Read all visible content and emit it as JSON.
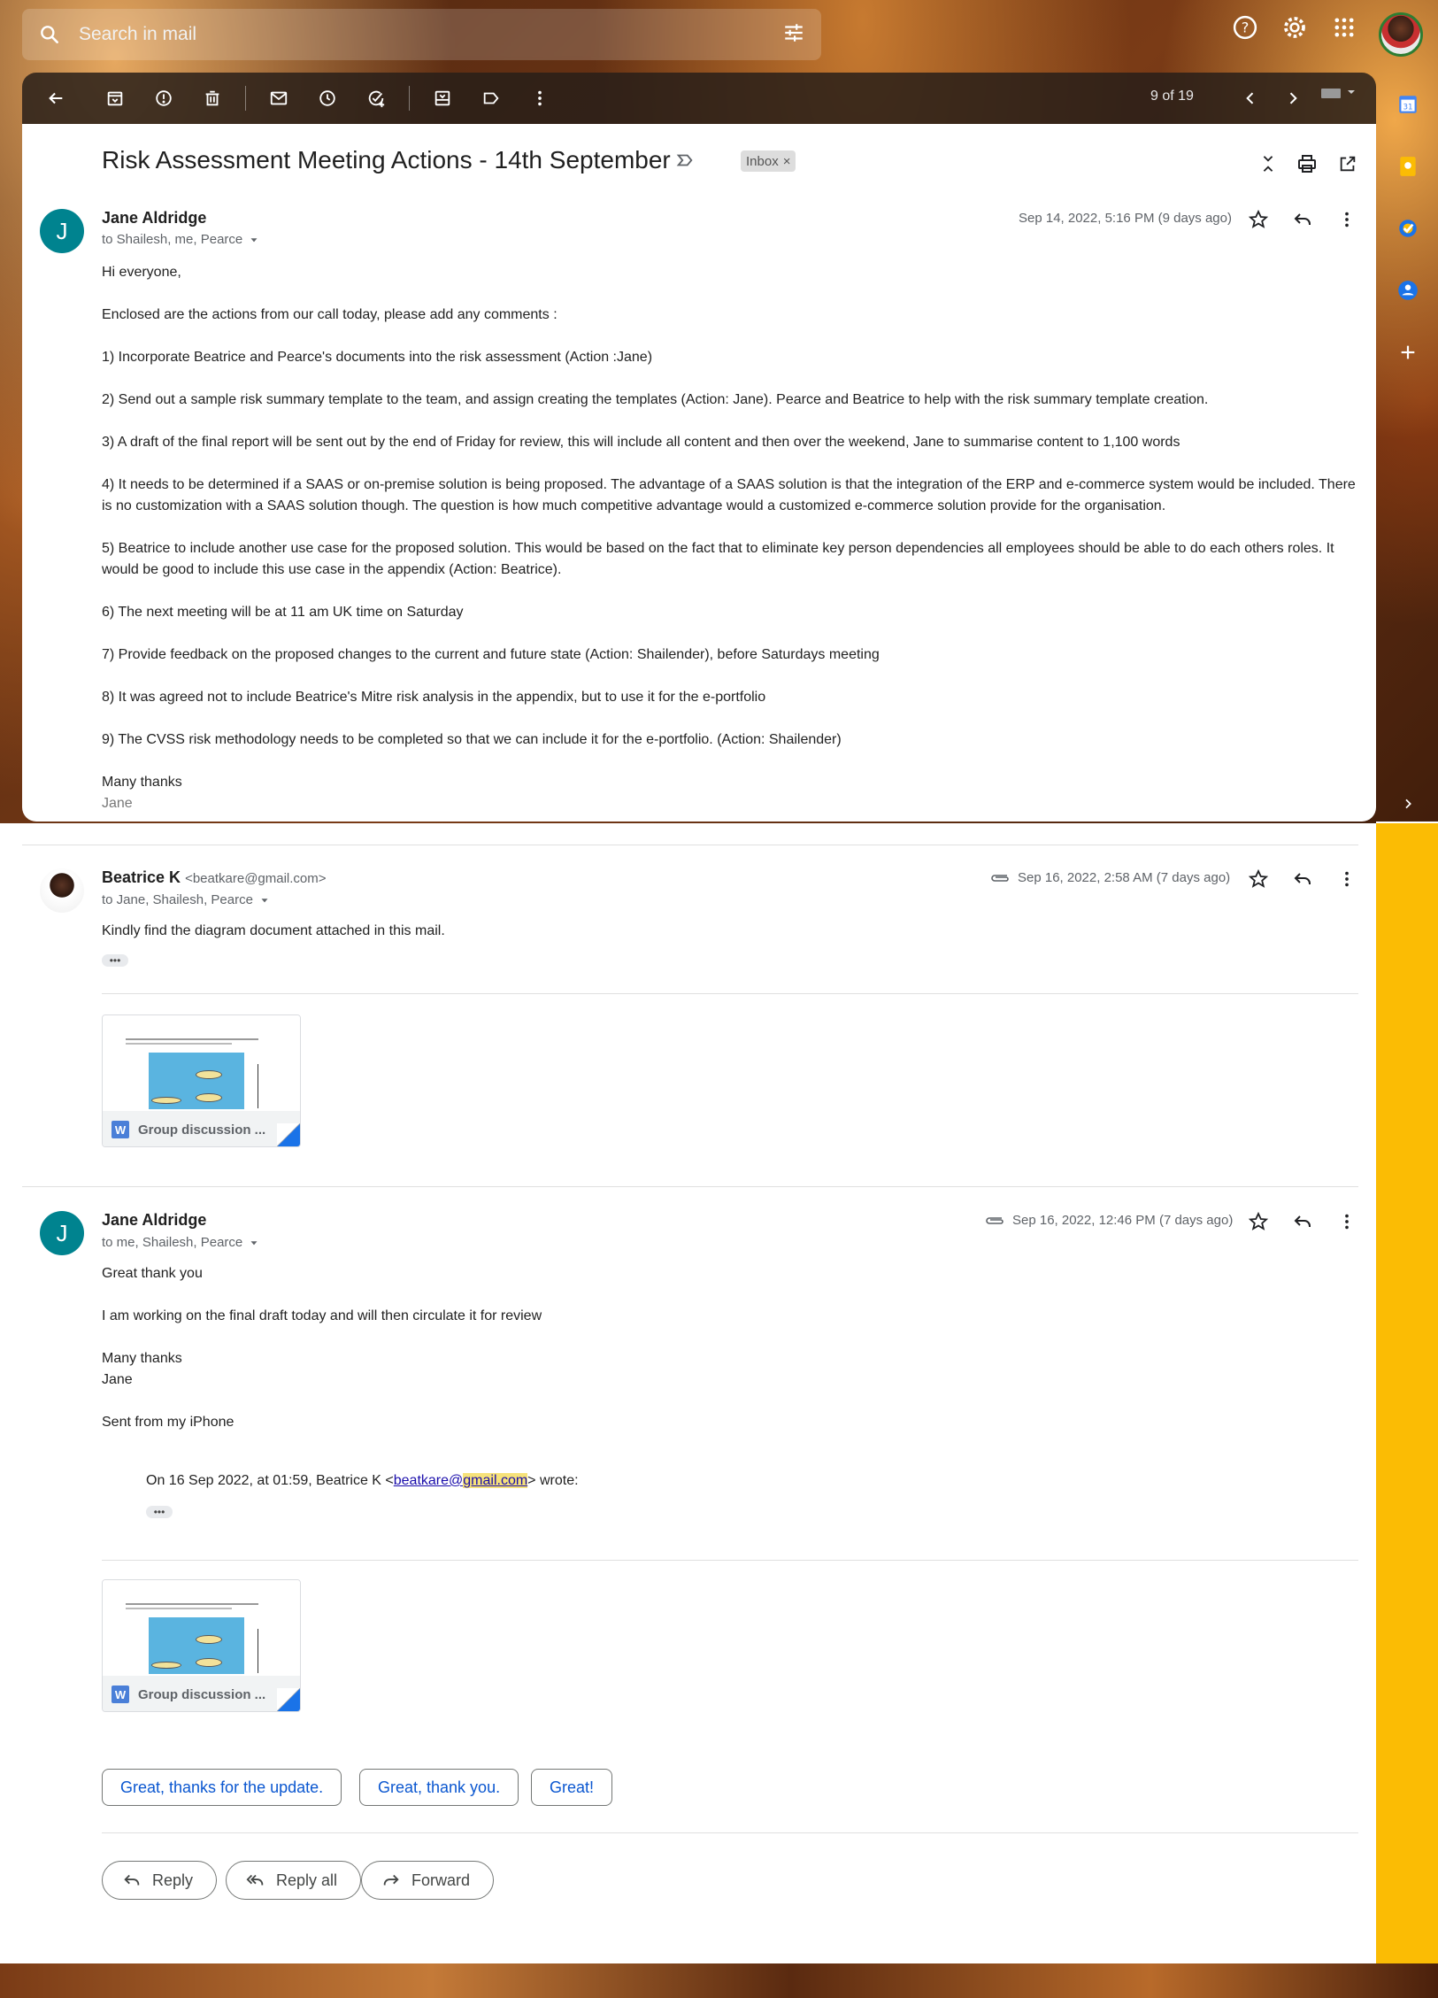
{
  "search": {
    "placeholder": "Search in mail"
  },
  "toolbar": {
    "count": "9 of 19"
  },
  "colors": {
    "accent": "#0b57d0",
    "avatar": "#00838f",
    "side_panel": "#fbbc04"
  },
  "thread": {
    "subject": "Risk Assessment Meeting Actions - 14th September",
    "label": "Inbox",
    "label_close": "×"
  },
  "messages": [
    {
      "avatar_letter": "J",
      "sender": "Jane Aldridge",
      "sender_email": "",
      "recipients": "to Shailesh, me, Pearce",
      "date": "Sep 14, 2022, 5:16 PM (9 days ago)",
      "body": [
        "Hi everyone,",
        "Enclosed are the actions from our call today, please add any comments :",
        "1) Incorporate Beatrice and Pearce's documents into the risk assessment (Action :Jane)",
        "2) Send out a sample risk summary template to the team, and assign creating the templates (Action: Jane). Pearce and Beatrice to help with the risk summary template creation.",
        "3) A draft of the final report will be sent out by the end of Friday for review, this will include all content and then over the weekend, Jane to summarise content to 1,100 words",
        "4) It needs to be determined if a SAAS or on-premise solution is being proposed. The advantage of  a SAAS solution is that the integration of the ERP and e-commerce system would be included. There is no customization with a SAAS solution though. The question is how much competitive advantage would a customized e-commerce solution provide for the organisation.",
        "5) Beatrice to include another use case for the proposed solution. This would be based on the fact that to eliminate key person dependencies all employees should be able to do each others roles. It would be good to include this use case in the appendix (Action: Beatrice).",
        "6) The next meeting will be at 11 am UK time on Saturday",
        "7) Provide feedback on the proposed changes to the current and future state (Action: Shailender), before Saturdays meeting",
        "8) It was agreed not to include Beatrice's Mitre risk analysis in the appendix, but to use it for the e-portfolio",
        "9) The CVSS risk methodology needs to be completed so that we can include it for the e-portfolio. (Action: Shailender)"
      ],
      "signoff": "Many thanks",
      "signature": "Jane"
    },
    {
      "sender": "Beatrice K",
      "sender_email": "<beatkare@gmail.com>",
      "recipients": "to Jane, Shailesh, Pearce",
      "date": "Sep 16, 2022, 2:58 AM (7 days ago)",
      "body": "Kindly find the diagram document attached in this mail.",
      "attachment": {
        "name": "Group discussion ...",
        "type_badge": "W"
      }
    },
    {
      "avatar_letter": "J",
      "sender": "Jane Aldridge",
      "recipients": "to me, Shailesh, Pearce",
      "date": "Sep 16, 2022, 12:46 PM (7 days ago)",
      "body": [
        "Great thank you",
        "I am working on the final draft today and will then circulate it for review"
      ],
      "signoff": "Many thanks",
      "signature": "Jane",
      "sent_from": "Sent from my iPhone",
      "quote_prefix": "On 16 Sep 2022, at 01:59, Beatrice K <",
      "quote_link_a": "beatkare@",
      "quote_link_b": "gmail.com",
      "quote_suffix": "> wrote:",
      "attachment": {
        "name": "Group discussion ...",
        "type_badge": "W"
      }
    }
  ],
  "smart_replies": [
    "Great, thanks for the update.",
    "Great, thank you.",
    "Great!"
  ],
  "actions": {
    "reply": "Reply",
    "reply_all": "Reply all",
    "forward": "Forward"
  },
  "dots": "•••"
}
